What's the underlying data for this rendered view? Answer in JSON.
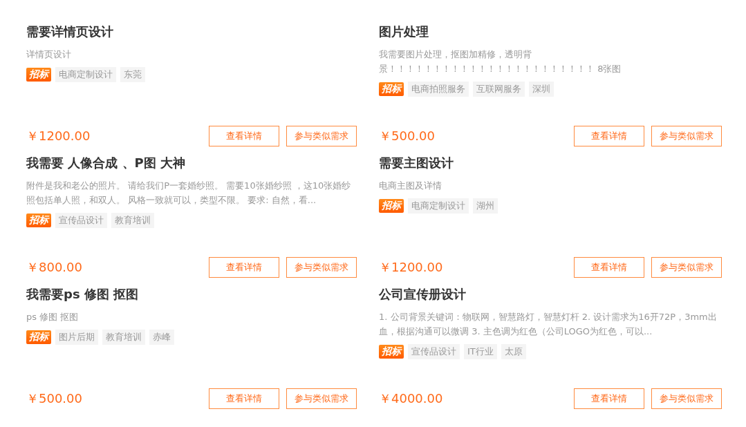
{
  "cards": [
    {
      "title": "需要详情页设计",
      "description": "详情页设计",
      "badge": "招标",
      "tags": [
        "电商定制设计",
        "东莞"
      ],
      "price": "￥1200.00",
      "buttons": [
        "查看详情",
        "参与类似需求"
      ]
    },
    {
      "title": "图片处理",
      "description": "我需要图片处理，抠图加精修，透明背景！！！！！！！！！！！！！！！！！！！！！！！ 8张图",
      "badge": "招标",
      "tags": [
        "电商拍照服务",
        "互联网服务",
        "深圳"
      ],
      "price": "￥500.00",
      "buttons": [
        "查看详情",
        "参与类似需求"
      ]
    },
    {
      "title": "我需要 人像合成 、P图 大神",
      "description": "附件是我和老公的照片。 请给我们P一套婚纱照。 需要10张婚纱照 ，这10张婚纱照包括单人照，和双人。 风格一致就可以，类型不限。 要求: 自然，看...",
      "badge": "招标",
      "tags": [
        "宣传品设计",
        "教育培训"
      ],
      "price": "￥800.00",
      "buttons": [
        "查看详情",
        "参与类似需求"
      ]
    },
    {
      "title": "需要主图设计",
      "description": "电商主图及详情",
      "badge": "招标",
      "tags": [
        "电商定制设计",
        "湖州"
      ],
      "price": "￥1200.00",
      "buttons": [
        "查看详情",
        "参与类似需求"
      ]
    },
    {
      "title": "我需要ps 修图 抠图",
      "description": "ps 修图 抠图",
      "badge": "招标",
      "tags": [
        "图片后期",
        "教育培训",
        "赤峰"
      ],
      "price": "￥500.00",
      "buttons": [
        "查看详情",
        "参与类似需求"
      ]
    },
    {
      "title": "公司宣传册设计",
      "description": "1. 公司背景关键词：物联网，智慧路灯，智慧灯杆 2. 设计需求为16开72P，3mm出血，根据沟通可以微调 3. 主色调为红色（公司LOGO为红色，可以...",
      "badge": "招标",
      "tags": [
        "宣传品设计",
        "IT行业",
        "太原"
      ],
      "price": "￥4000.00",
      "buttons": [
        "查看详情",
        "参与类似需求"
      ]
    }
  ]
}
